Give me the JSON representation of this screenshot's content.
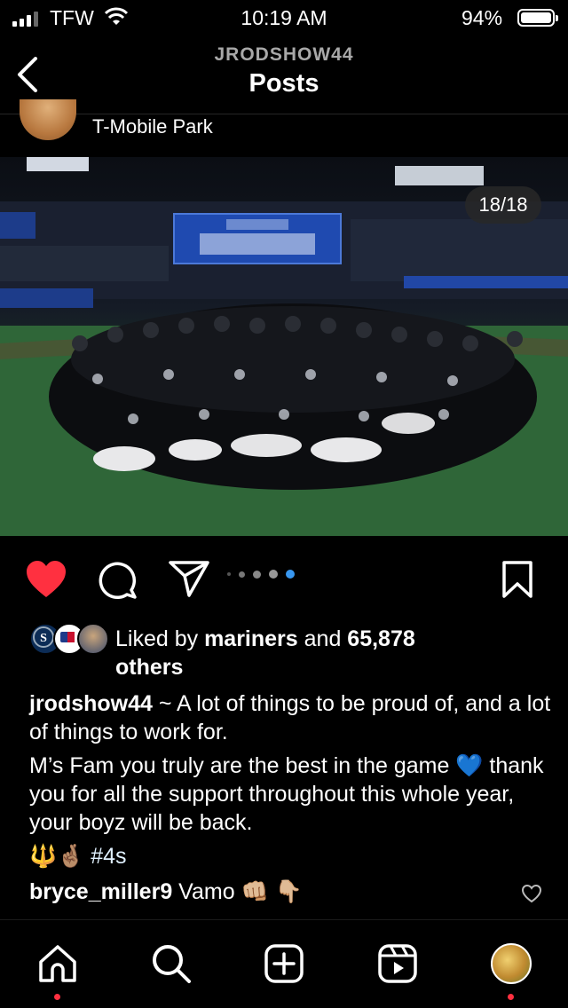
{
  "status_bar": {
    "carrier": "TFW",
    "time": "10:19 AM",
    "battery": "94%"
  },
  "header": {
    "username": "JRODSHOW44",
    "title": "Posts"
  },
  "post": {
    "location": "T-Mobile Park",
    "photo_counter": "18/18",
    "carousel": {
      "dot_count": 5,
      "active_index": 4
    },
    "likes": {
      "prefix": "Liked by ",
      "user": "mariners",
      "middle": " and ",
      "count": "65,878",
      "suffix": " others"
    },
    "caption": {
      "author": "jrodshow44",
      "line1": " ~ A lot of things to be proud of, and a lot of things to work for.",
      "para2_a": "M’s Fam you truly are the best in the game ",
      "heart_emoji": "💙",
      "para2_b": " thank you for all the support throughout this whole year, your boyz will be back.",
      "emoji_line": "🔱🤞🏽 ",
      "hashtag": "#4s"
    },
    "comment": {
      "author": "bryce_miller9",
      "text": " Vamo 👊🏼 👇🏼"
    }
  },
  "nav": {
    "items": [
      "home-icon",
      "search-icon",
      "create-icon",
      "reels-icon",
      "profile-avatar"
    ]
  },
  "colors": {
    "like_red": "#ff3040",
    "carousel_active": "#3897f0",
    "background": "#000000"
  }
}
